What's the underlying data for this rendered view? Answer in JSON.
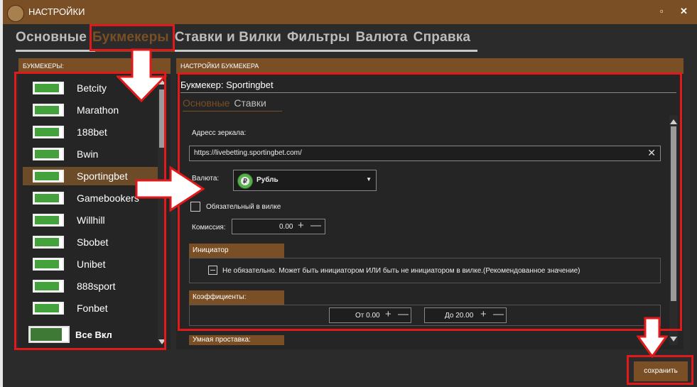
{
  "window": {
    "title": "НАСТРОЙКИ",
    "minimize": "▫",
    "close": "✕"
  },
  "tabs": [
    "Основные",
    "Букмекеры",
    "Ставки и Вилки",
    "Фильтры",
    "Валюта",
    "Справка"
  ],
  "active_tab": "Букмекеры",
  "left_panel": {
    "header": "БУКМЕКЕРЫ:",
    "items": [
      {
        "label": "Betcity",
        "enabled": true
      },
      {
        "label": "Marathon",
        "enabled": true
      },
      {
        "label": "188bet",
        "enabled": true
      },
      {
        "label": "Bwin",
        "enabled": true
      },
      {
        "label": "Sportingbet",
        "enabled": true,
        "selected": true
      },
      {
        "label": "Gamebookers",
        "enabled": true
      },
      {
        "label": "Willhill",
        "enabled": true
      },
      {
        "label": "Sbobet",
        "enabled": true
      },
      {
        "label": "Unibet",
        "enabled": true
      },
      {
        "label": "888sport",
        "enabled": true
      },
      {
        "label": "Fonbet",
        "enabled": true
      }
    ],
    "all_toggle_label": "Все Вкл"
  },
  "right_panel": {
    "header": "НАСТРОЙКИ БУКМЕКЕРА",
    "bookmaker_title": "Букмекер: Sportingbet",
    "subtabs": [
      "Основные",
      "Ставки"
    ],
    "mirror_label": "Адресс зеркала:",
    "mirror_value": "https://livebetting.sportingbet.com/",
    "currency_label": "Валюта:",
    "currency_value": "Рубль",
    "required_label": "Обязательный в вилке",
    "commission_label": "Комиссия:",
    "commission_value": "0.00",
    "initiator_header": "Инициатор",
    "initiator_text": "Не обязательно. Может быть инициатором ИЛИ быть не инициатором в вилке.(Рекомендованное значение)",
    "coef_header": "Коэффициенты:",
    "coef_from": "От 0.00",
    "coef_to": "До 20.00",
    "smart_header": "Умная проставка:"
  },
  "save_button": "сохранить",
  "colors": {
    "accent": "#7a4f25",
    "toggle_green": "#43a23c",
    "highlight_red": "#e01a1a"
  }
}
